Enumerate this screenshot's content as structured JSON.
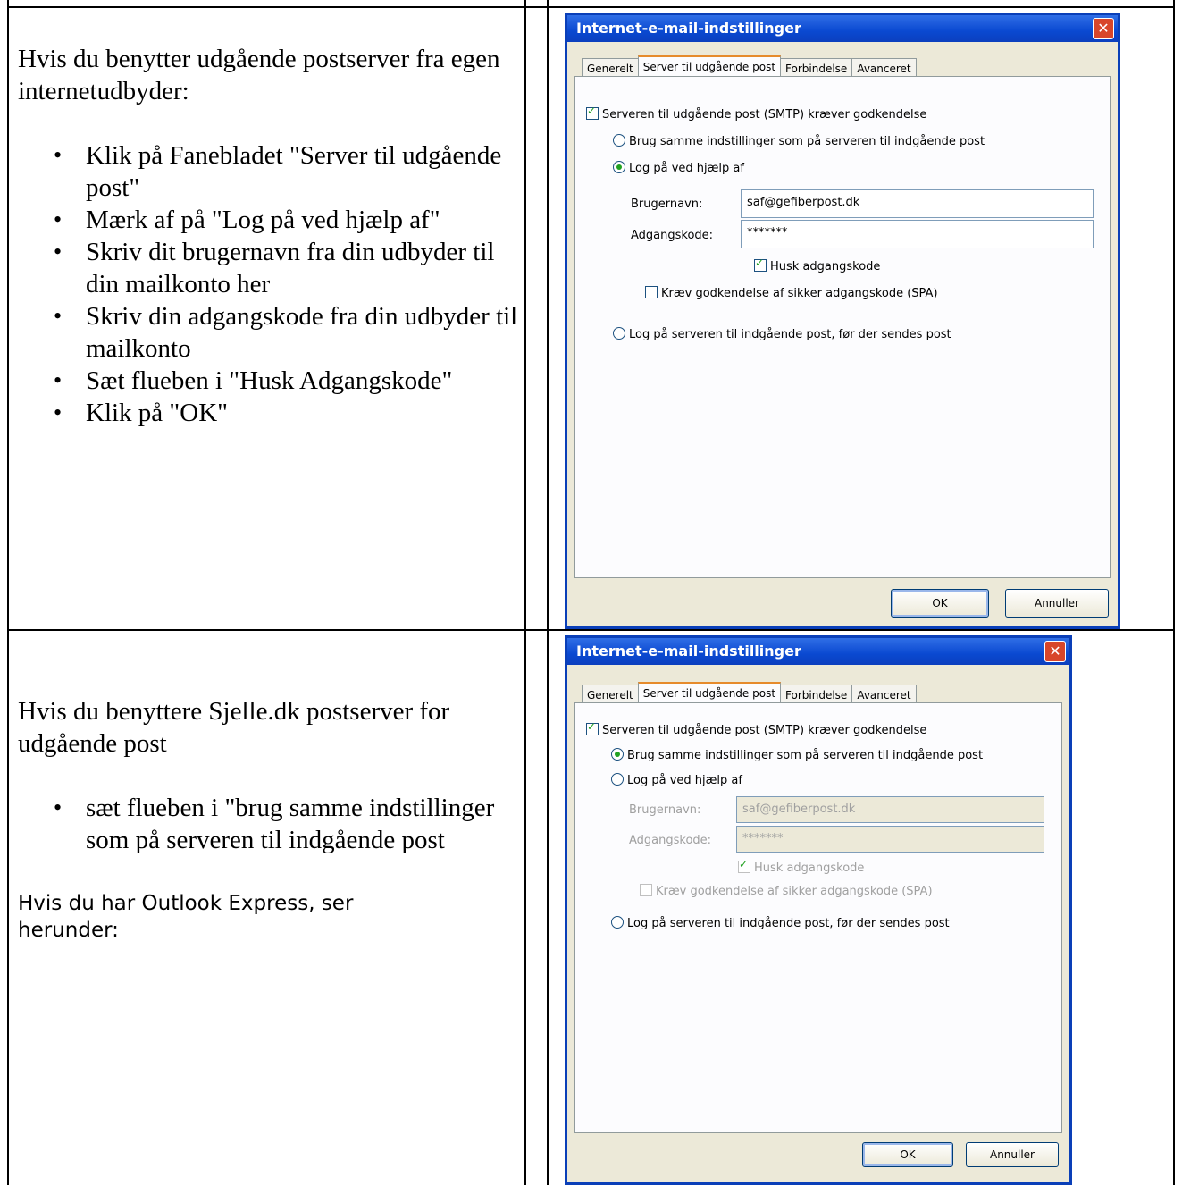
{
  "row1": {
    "intro": "Hvis du benytter udgående postserver fra egen internetudbyder:",
    "steps": [
      "Klik på Fanebladet \"Server til udgående post\"",
      "Mærk af på \"Log på ved  hjælp af\"",
      "Skriv dit brugernavn fra din udbyder til din mailkonto her",
      "Skriv din adgangskode fra din udbyder til mailkonto",
      "Sæt flueben i \"Husk Adgangskode\"",
      "Klik på \"OK\""
    ]
  },
  "row2": {
    "intro": "Hvis du benyttere Sjelle.dk postserver for udgående post",
    "steps": [
      "sæt flueben i \"brug samme indstillinger som på serveren til indgående post"
    ],
    "note": "Hvis du har Outlook Express, ser herunder:"
  },
  "dialog": {
    "title": "Internet-e-mail-indstillinger",
    "close_icon": "close-icon",
    "tabs": [
      "Generelt",
      "Server til udgående post",
      "Forbindelse",
      "Avanceret"
    ],
    "smtp_auth_label": "Serveren til udgående post (SMTP) kræver godkendelse",
    "same_settings_label": "Brug samme indstillinger som på serveren til indgående post",
    "logon_using_label": "Log på ved hjælp af",
    "username_label": "Brugernavn:",
    "username_value": "saf@gefiberpost.dk",
    "password_label": "Adgangskode:",
    "password_value": "*******",
    "remember_label": "Husk adgangskode",
    "spa_label": "Kræv godkendelse af sikker adgangskode (SPA)",
    "log_before_label": "Log på serveren til indgående post, før der sendes post",
    "ok_label": "OK",
    "cancel_label": "Annuller"
  }
}
